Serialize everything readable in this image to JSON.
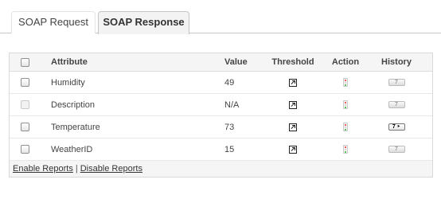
{
  "tabs": [
    {
      "label": "SOAP Request",
      "active": false
    },
    {
      "label": "SOAP Response",
      "active": true
    }
  ],
  "table": {
    "headers": {
      "attribute": "Attribute",
      "value": "Value",
      "threshold": "Threshold",
      "action": "Action",
      "history": "History"
    },
    "rows": [
      {
        "attribute": "Humidity",
        "value": "49",
        "checkbox_enabled": true,
        "history_active": false
      },
      {
        "attribute": "Description",
        "value": "N/A",
        "checkbox_enabled": false,
        "history_active": false
      },
      {
        "attribute": "Temperature",
        "value": "73",
        "checkbox_enabled": true,
        "history_active": true
      },
      {
        "attribute": "WeatherID",
        "value": "15",
        "checkbox_enabled": true,
        "history_active": false
      }
    ]
  },
  "icons": {
    "threshold": "threshold-edit-icon",
    "action": "traffic-light-icon",
    "history": "history-chart-icon"
  },
  "footer": {
    "enable_label": "Enable Reports",
    "separator": "|",
    "disable_label": "Disable Reports"
  }
}
